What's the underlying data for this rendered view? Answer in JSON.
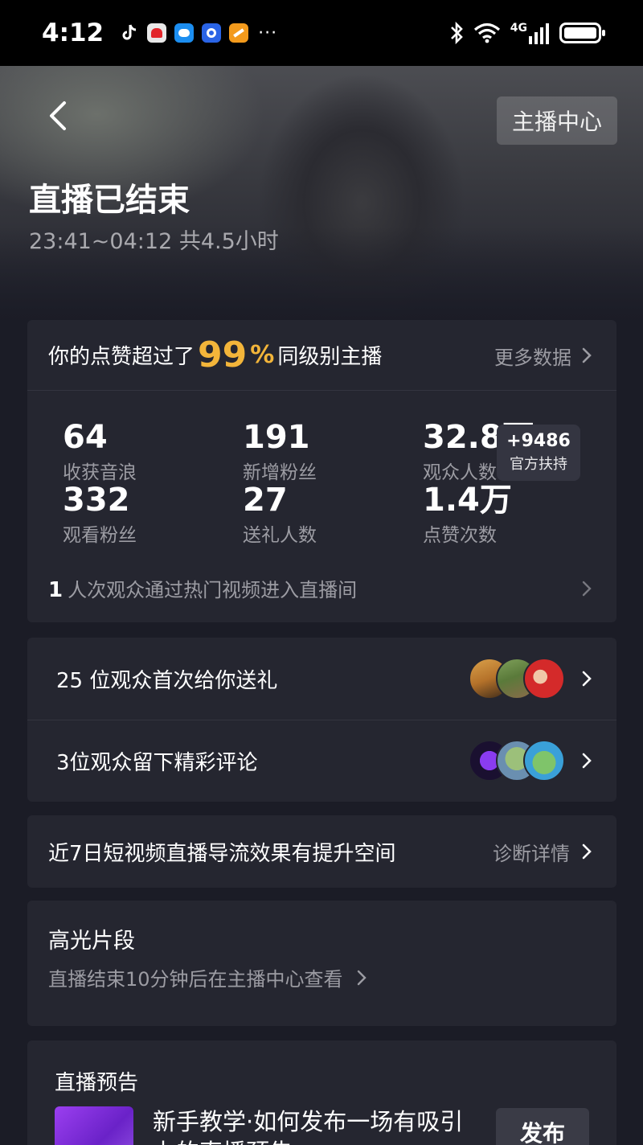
{
  "status_bar": {
    "time": "4:12",
    "more_indicator": "···",
    "network": "4G",
    "icons": [
      "tiktok-icon",
      "app-red-icon",
      "chat-icon",
      "download-icon",
      "app-orange-icon",
      "bluetooth-icon",
      "wifi-icon",
      "signal-icon",
      "battery-icon"
    ]
  },
  "header": {
    "back_icon": "chevron-left-icon",
    "anchor_center": "主播中心",
    "title": "直播已结束",
    "subtitle": "23:41~04:12 共4.5小时"
  },
  "summary": {
    "lead": "你的点赞超过了",
    "percent": "99",
    "percent_sign": "%",
    "tail": "同级别主播",
    "more_data": "更多数据",
    "stats": [
      {
        "value": "64",
        "label": "收获音浪"
      },
      {
        "value": "191",
        "label": "新增粉丝"
      },
      {
        "value": "32.8万",
        "label": "观众人数"
      },
      {
        "value": "332",
        "label": "观看粉丝"
      },
      {
        "value": "27",
        "label": "送礼人数"
      },
      {
        "value": "1.4万",
        "label": "点赞次数"
      }
    ],
    "support": {
      "plus": "+9486",
      "label": "官方扶持"
    },
    "hot_count": "1",
    "hot_text": "人次观众通过热门视频进入直播间"
  },
  "audience": {
    "first_gift": "25 位观众首次给你送礼",
    "comments": "3位观众留下精彩评论"
  },
  "flow": {
    "text": "近7日短视频直播导流效果有提升空间",
    "action": "诊断详情"
  },
  "highlights": {
    "title": "高光片段",
    "subtitle": "直播结束10分钟后在主播中心查看"
  },
  "preview": {
    "title": "直播预告",
    "item_text": "新手教学·如何发布一场有吸引力的直播预告",
    "publish": "发布"
  },
  "colors": {
    "accent": "#f3b53a",
    "background": "#1b1c26",
    "card": "#252630",
    "secondary_text": "#9c9ca3"
  }
}
